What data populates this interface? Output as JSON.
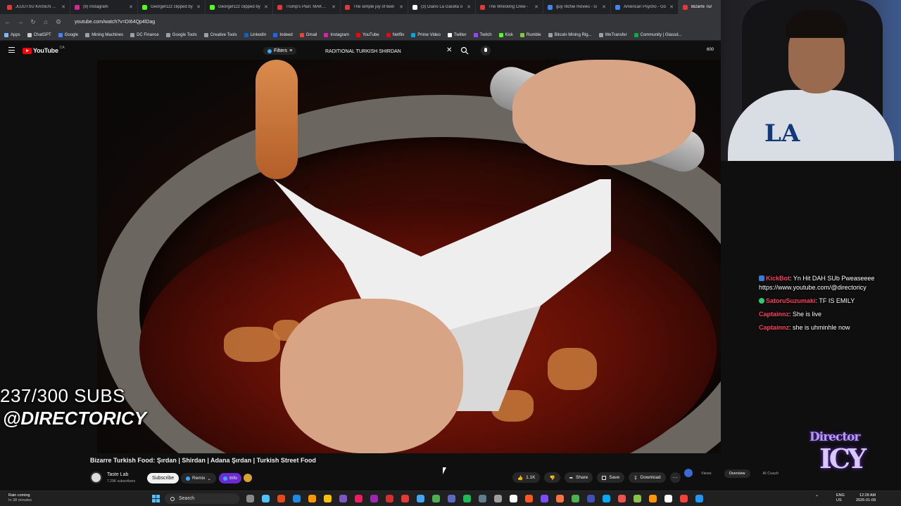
{
  "browser": {
    "tabs": [
      {
        "title": "JUJUTSU KAISEN The C",
        "color": "#e53935",
        "active": false
      },
      {
        "title": "(9) Instagram",
        "color": "#d6249f",
        "active": false
      },
      {
        "title": "Georgef1zz clipped by",
        "color": "#53fc18",
        "active": false
      },
      {
        "title": "Georgef1zz clipped by",
        "color": "#53fc18",
        "active": false
      },
      {
        "title": "Trump's Plan: MAKE C",
        "color": "#e53935",
        "active": false
      },
      {
        "title": "The simple joy of bein",
        "color": "#e53935",
        "active": false
      },
      {
        "title": "(3) Diario La Gaceta o",
        "color": "#ffffff",
        "active": false
      },
      {
        "title": "The Wrecking Crew -",
        "color": "#e53935",
        "active": false
      },
      {
        "title": "guy ritchie movies - G",
        "color": "#4285f4",
        "active": false
      },
      {
        "title": "American Psycho - Go",
        "color": "#4285f4",
        "active": false
      },
      {
        "title": "Bizarre Tur",
        "color": "#e53935",
        "active": true
      }
    ],
    "url": "youtube.com/watch?v=DI64Qp4lDag",
    "bookmarks": [
      {
        "label": "Apps",
        "color": "#8ab4f8"
      },
      {
        "label": "ChatGPT",
        "color": "#cccccc"
      },
      {
        "label": "Google",
        "color": "#4285f4"
      },
      {
        "label": "Mining Machines",
        "color": "#9aa0a6"
      },
      {
        "label": "DC Finance",
        "color": "#9aa0a6"
      },
      {
        "label": "Google Tools",
        "color": "#9aa0a6"
      },
      {
        "label": "Creative Tools",
        "color": "#9aa0a6"
      },
      {
        "label": "LinkedIn",
        "color": "#0a66c2"
      },
      {
        "label": "Indeed",
        "color": "#2164f3"
      },
      {
        "label": "Gmail",
        "color": "#ea4335"
      },
      {
        "label": "Instagram",
        "color": "#d6249f"
      },
      {
        "label": "YouTube",
        "color": "#ff0000"
      },
      {
        "label": "Netflix",
        "color": "#e50914"
      },
      {
        "label": "Prime Video",
        "color": "#00a8e1"
      },
      {
        "label": "Twitter",
        "color": "#ffffff"
      },
      {
        "label": "Twitch",
        "color": "#9146ff"
      },
      {
        "label": "Kick",
        "color": "#53fc18"
      },
      {
        "label": "Rumble",
        "color": "#85c742"
      },
      {
        "label": "Bitcoin Mining Rig...",
        "color": "#9aa0a6"
      },
      {
        "label": "WeTransfer",
        "color": "#9aa0a6"
      },
      {
        "label": "Community | Glassd...",
        "color": "#0caa41"
      }
    ]
  },
  "youtube": {
    "logo_text": "YouTube",
    "country": "CA",
    "filters_label": "Filters",
    "search_value": "RADITIONAL TURKISH SHIRDAN",
    "header_count": "600",
    "video_title": "Bizarre Turkish Food: Şırdan | Shirdan | Adana Şırdan | Turkish Street Food",
    "channel_name": "Taste Lab",
    "channel_subs": "7.29K subscribers",
    "subscribe_label": "Subscribe",
    "remix_label": "Remix",
    "info_label": "Info",
    "like_count": "1.1K",
    "share_label": "Share",
    "save_label": "Save",
    "download_label": "Download",
    "more_label": "···",
    "segments": [
      "Views",
      "Overview",
      "AI Coach"
    ]
  },
  "stream": {
    "sub_goal": "237/300 SUBS",
    "handle": "@DIRECTORICY",
    "logo_line1": "Director",
    "logo_line2": "ICY",
    "chat": [
      {
        "user": "KickBot",
        "user_color": "#ff3b5c",
        "badge": "bot",
        "text": ": Yn Hit DAH SUb Pweaseeee https://www.youtube.com/@directoricy"
      },
      {
        "user": "SatoruSuzumaki",
        "user_color": "#ff3b5c",
        "badge": "sub",
        "text": ": TF IS EMILY"
      },
      {
        "user": "Captainnz",
        "user_color": "#ff3b5c",
        "badge": "",
        "text": ": She is live"
      },
      {
        "user": "Captainnz",
        "user_color": "#ff3b5c",
        "badge": "",
        "text": ": she is uhminhle now"
      }
    ]
  },
  "taskbar": {
    "weather_line1": "Rain coming",
    "weather_line2": "In 38 minutes",
    "search_label": "Search",
    "lang_line1": "ENG",
    "lang_line2": "US",
    "time": "12:28 AM",
    "date": "2026-01-09"
  }
}
